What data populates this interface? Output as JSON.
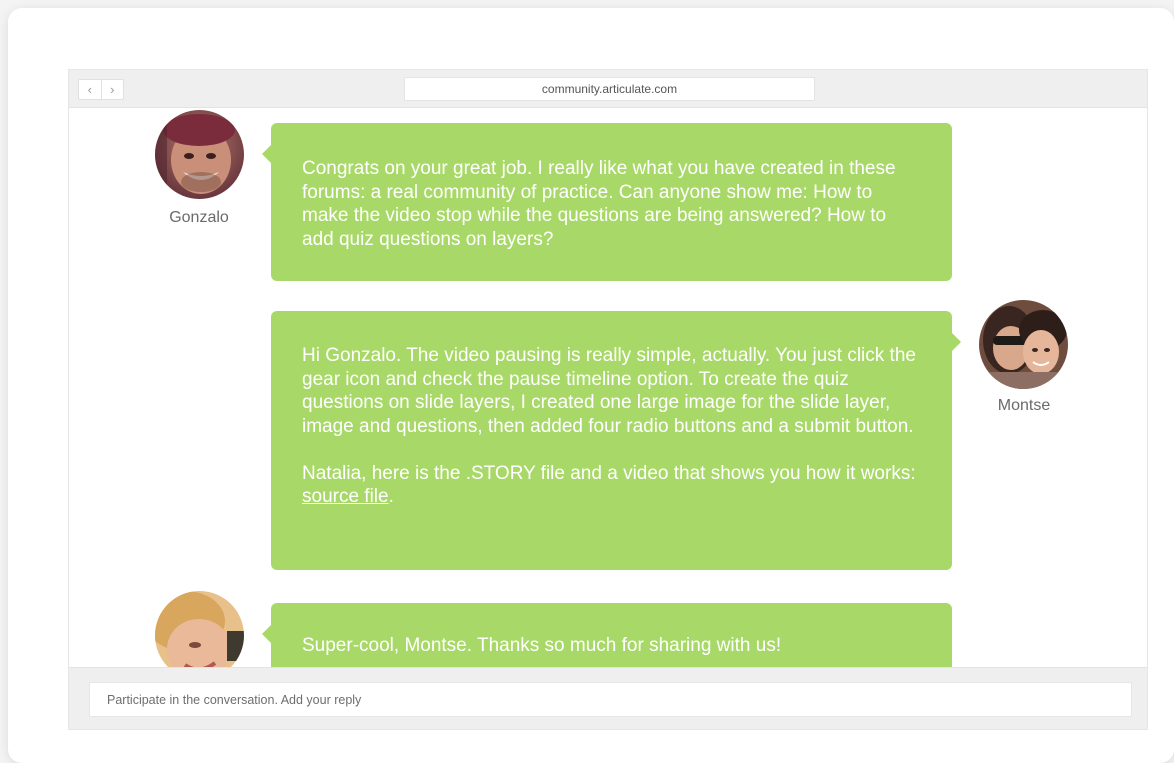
{
  "browser": {
    "back_glyph": "‹",
    "forward_glyph": "›",
    "url": "community.articulate.com"
  },
  "theme": {
    "bubble_color": "#a8d968",
    "bubble_text": "#ffffff"
  },
  "messages": [
    {
      "author": "Gonzalo",
      "side": "left",
      "paragraphs": [
        "Congrats on your great job. I really like what you have created in these forums: a real community of practice. Can anyone show me: How to make the video stop while the questions are being answered? How to add quiz questions on layers?"
      ]
    },
    {
      "author": "Montse",
      "side": "right",
      "paragraphs": [
        "Hi Gonzalo. The video pausing is really simple, actually. You just click the gear icon and check the pause timeline option. To create the quiz questions on slide layers, I created one large image for the slide layer, image and questions, then added four radio buttons and a submit button."
      ],
      "closing_prefix": "Natalia, here is the .STORY file and a video that shows you how it works: ",
      "closing_link": "source file",
      "closing_suffix": "."
    },
    {
      "author": "",
      "side": "left",
      "paragraphs": [
        "Super-cool, Montse. Thanks so much for sharing with us!"
      ]
    }
  ],
  "reply": {
    "placeholder": "Participate in the conversation. Add your reply"
  }
}
